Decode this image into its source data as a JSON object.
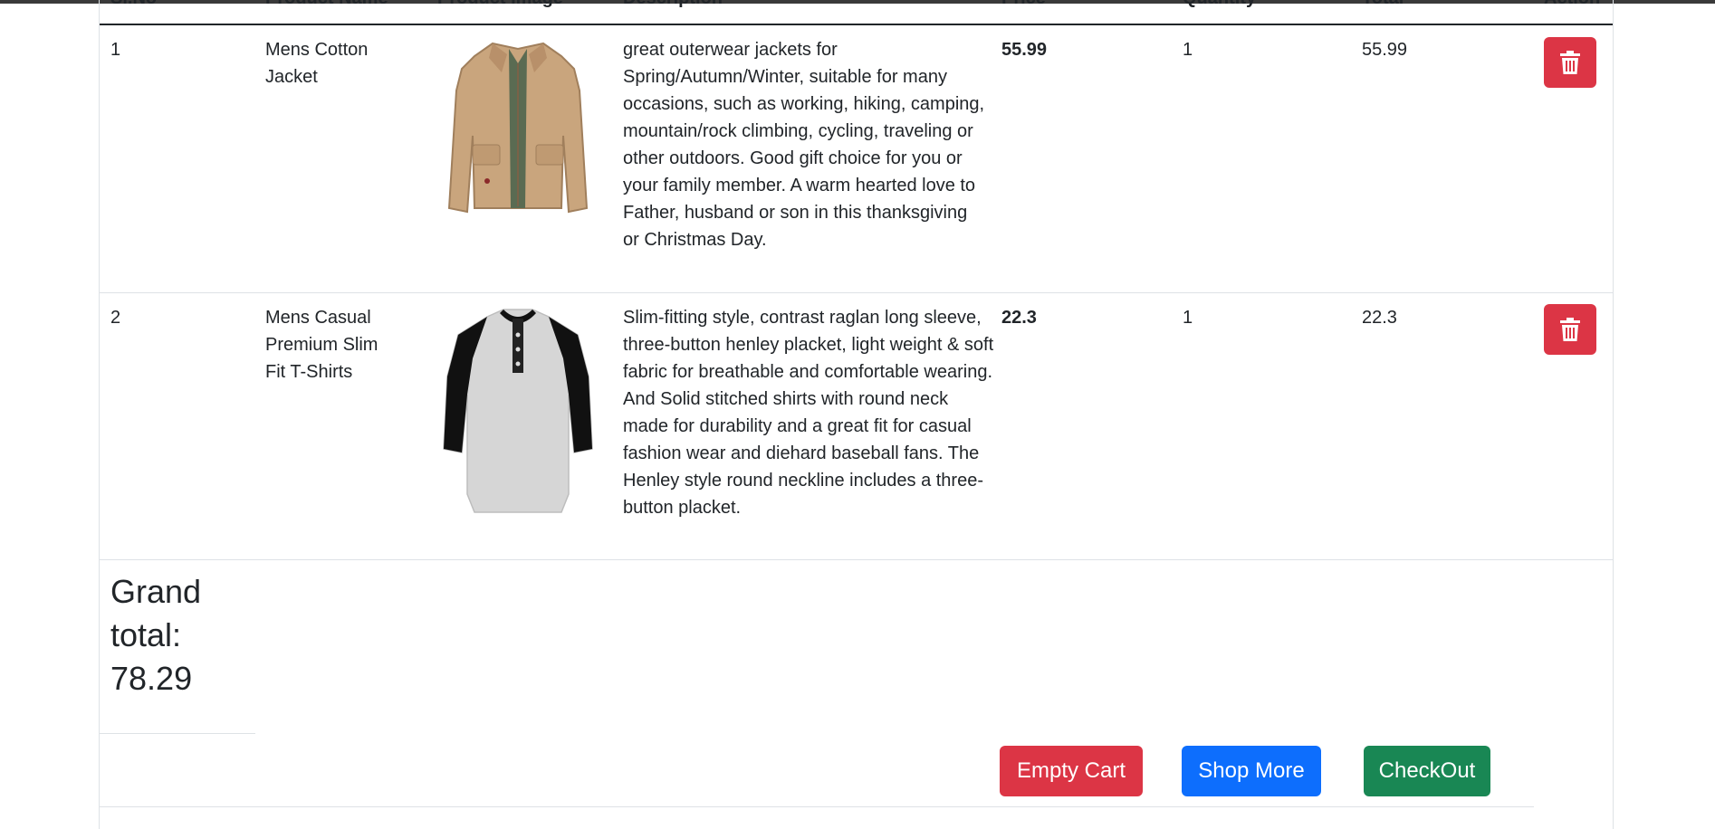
{
  "table": {
    "headers": {
      "slno": "Sl.No",
      "name": "Product Name",
      "image": "Product Image",
      "description": "Description",
      "price": "Price",
      "quantity": "Quantity",
      "total": "Total",
      "action": "Action"
    },
    "rows": [
      {
        "slno": "1",
        "name": "Mens Cotton Jacket",
        "image_icon": "jacket-image",
        "description": "great outerwear jackets for Spring/Autumn/Winter, suitable for many occasions, such as working, hiking, camping, mountain/rock climbing, cycling, traveling or other outdoors. Good gift choice for you or your family member. A warm hearted love to Father, husband or son in this thanksgiving or Christmas Day.",
        "price": "55.99",
        "quantity": "1",
        "total": "55.99",
        "action_icon": "trash-icon"
      },
      {
        "slno": "2",
        "name": "Mens Casual Premium Slim Fit T-Shirts",
        "image_icon": "tshirt-image",
        "description": "Slim-fitting style, contrast raglan long sleeve, three-button henley placket, light weight & soft fabric for breathable and comfortable wearing. And Solid stitched shirts with round neck made for durability and a great fit for casual fashion wear and diehard baseball fans. The Henley style round neckline includes a three-button placket.",
        "price": "22.3",
        "quantity": "1",
        "total": "22.3",
        "action_icon": "trash-icon"
      }
    ]
  },
  "summary": {
    "grand_total_label": "Grand total:",
    "grand_total_value": "78.29"
  },
  "buttons": {
    "empty_cart": "Empty Cart",
    "shop_more": "Shop More",
    "checkout": "CheckOut"
  },
  "colors": {
    "danger": "#dc3545",
    "primary": "#0d6efd",
    "success": "#198754"
  }
}
